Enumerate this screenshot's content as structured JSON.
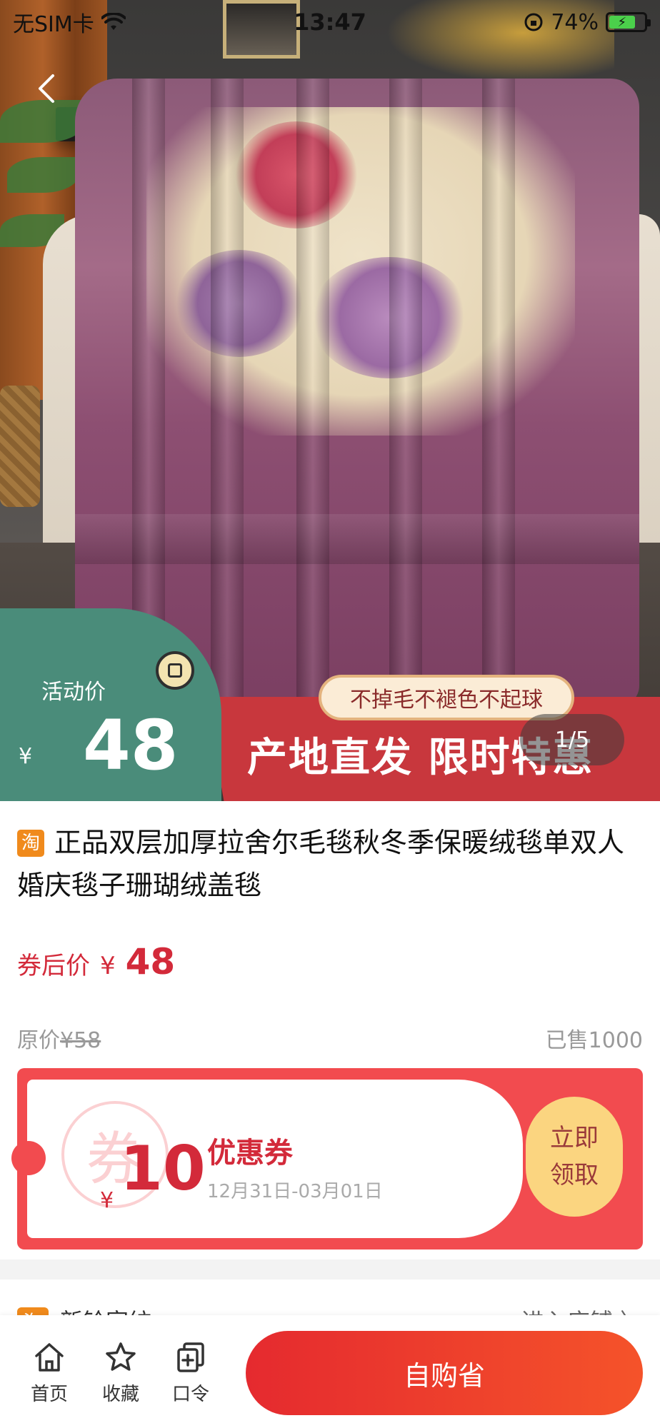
{
  "status_bar": {
    "carrier": "无SIM卡",
    "time": "13:47",
    "battery": "74%"
  },
  "hero": {
    "image_alt": "毛毯产品图",
    "counter": "1/5",
    "promo_label": "活动价",
    "promo_currency": "¥",
    "promo_price": "48",
    "promo_tag": "不掉毛不褪色不起球",
    "promo_slogan": "产地直发 限时特惠"
  },
  "product": {
    "platform_badge": "淘",
    "title": "正品双层加厚拉舍尔毛毯秋冬季保暖绒毯单双人婚庆毯子珊瑚绒盖毯",
    "after_coupon_label": "券后价",
    "after_coupon_currency": "¥",
    "after_coupon_price": "48",
    "original_price_label": "原价",
    "original_price": "¥58",
    "sold": "已售1000"
  },
  "coupon": {
    "watermark": "券",
    "currency": "¥",
    "value": "10",
    "name": "优惠券",
    "date_range": "12月31日-03月01日",
    "claim_line1": "立即",
    "claim_line2": "领取"
  },
  "shop": {
    "badge": "淘",
    "name": "新铃家纺",
    "enter": "进入店铺 〉"
  },
  "bottom_nav": {
    "home": "首页",
    "favorite": "收藏",
    "code": "口令",
    "buy": "自购省"
  },
  "colors": {
    "accent_red": "#e52a2f",
    "promo_green": "#4a8c7a",
    "coupon_red": "#f24b4f",
    "coupon_gold": "#fbd580"
  }
}
